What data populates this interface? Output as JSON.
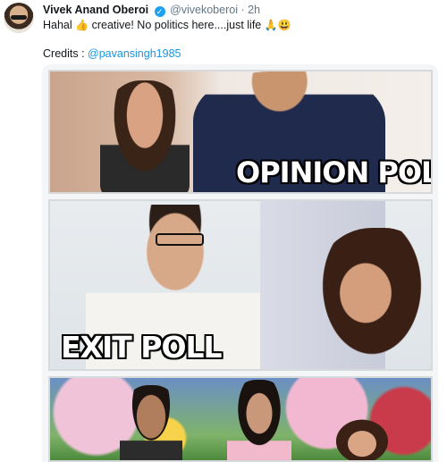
{
  "tweet": {
    "display_name": "Vivek Anand Oberoi",
    "handle": "@vivekoberoi",
    "separator": "·",
    "time": "2h",
    "text_part1": "Hahal",
    "emoji_thumb": "👍",
    "text_part2": "creative! No politics here....just life",
    "emoji_pray": "🙏",
    "emoji_smile": "😃",
    "credits_label": "Credits :",
    "credits_handle": "@pavansingh1985"
  },
  "meme": {
    "caption_top": "OPINION POLL",
    "caption_middle": "EXIT POLL"
  },
  "colors": {
    "link": "#1b95e0",
    "verified": "#1da1f2",
    "meta_gray": "#657786"
  }
}
